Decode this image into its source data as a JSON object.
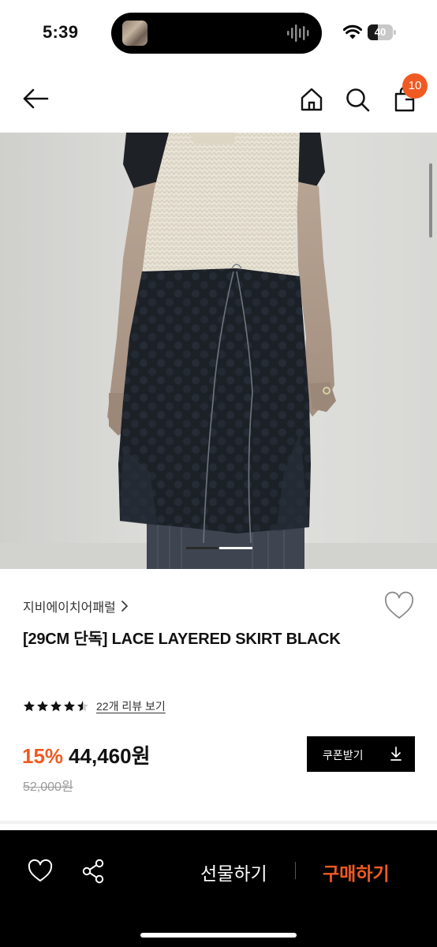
{
  "status_bar": {
    "time": "5:39",
    "battery_level": "40",
    "icons": [
      "wifi-icon",
      "battery-icon",
      "audio-waveform-icon"
    ]
  },
  "header": {
    "cart_count": "10",
    "icons": [
      "back-arrow-icon",
      "home-icon",
      "search-icon",
      "shopping-bag-icon"
    ]
  },
  "gallery": {
    "current_slide": 1,
    "slide_count": 2
  },
  "product": {
    "brand": "지비에이치어패럴",
    "title": "[29CM 단독] LACE LAYERED SKIRT BLACK",
    "rating": 4.5,
    "review_link": "22개 리뷰 보기",
    "discount": "15%",
    "sale_price": "44,460원",
    "original_price": "52,000원",
    "coupon_label": "쿠폰받기"
  },
  "bottom_bar": {
    "gift_label": "선물하기",
    "buy_label": "구매하기",
    "icons": [
      "heart-icon",
      "share-icon"
    ]
  },
  "colors": {
    "accent": "#f05a22",
    "dark": "#000000",
    "text": "#111111",
    "muted": "#9a9a9a"
  }
}
